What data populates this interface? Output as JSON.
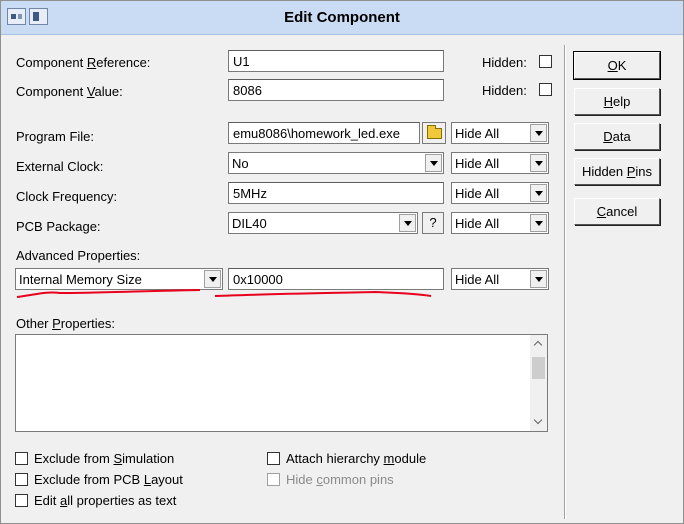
{
  "window": {
    "title": "Edit Component"
  },
  "fields": {
    "component_reference": {
      "label_pre": "Component ",
      "label_u": "R",
      "label_post": "eference:",
      "value": "U1",
      "hidden_label": "Hidden:"
    },
    "component_value": {
      "label_pre": "Component ",
      "label_u": "V",
      "label_post": "alue:",
      "value": "8086",
      "hidden_label": "Hidden:"
    },
    "program_file": {
      "label": "Program File:",
      "value": "emu8086\\homework_led.exe",
      "visibility": "Hide All"
    },
    "external_clock": {
      "label": "External Clock:",
      "value": "No",
      "visibility": "Hide All"
    },
    "clock_frequency": {
      "label": "Clock Frequency:",
      "value": "5MHz",
      "visibility": "Hide All"
    },
    "pcb_package": {
      "label": "PCB Package:",
      "value": "DIL40",
      "help": "?",
      "visibility": "Hide All"
    },
    "advanced_properties": {
      "label": "Advanced Properties:",
      "property": "Internal Memory Size",
      "value": "0x10000",
      "visibility": "Hide All"
    },
    "other_properties": {
      "label_pre": "Other ",
      "label_u": "P",
      "label_post": "roperties:",
      "value": ""
    }
  },
  "checkboxes": {
    "exclude_simulation": {
      "pre": "Exclude from ",
      "u": "S",
      "post": "imulation",
      "checked": false
    },
    "exclude_pcb": {
      "pre": "Exclude from PCB ",
      "u": "L",
      "post": "ayout",
      "checked": false
    },
    "edit_all": {
      "pre": "Edit ",
      "u": "a",
      "post": "ll properties as text",
      "checked": false
    },
    "attach_hierarchy": {
      "pre": "Attach hierarchy ",
      "u": "m",
      "post": "odule",
      "checked": false
    },
    "hide_common_pins": {
      "pre": "Hide ",
      "u": "c",
      "post": "ommon pins",
      "checked": false,
      "disabled": true
    }
  },
  "buttons": {
    "ok": {
      "u": "O",
      "post": "K"
    },
    "help": {
      "u": "H",
      "post": "elp"
    },
    "data": {
      "u": "D",
      "post": "ata"
    },
    "hidden_pins": {
      "pre": "Hidden ",
      "u": "P",
      "post": "ins"
    },
    "cancel": {
      "u": "C",
      "post": "ancel"
    }
  },
  "colors": {
    "annotation": "#e8001c",
    "titlebar": "#c9dcf3",
    "disabled_text": "#8a8a8a"
  }
}
